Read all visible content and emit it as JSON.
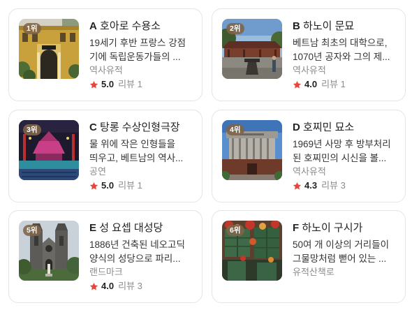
{
  "places": [
    {
      "rank_label": "1위",
      "letter": "A",
      "name": "호아로 수용소",
      "description_lines": [
        "19세기 후반 프랑스 강점",
        "기에 독립운동가들의 ..."
      ],
      "category": "역사유적",
      "rating": "5.0",
      "reviews": "리뷰 1"
    },
    {
      "rank_label": "2위",
      "letter": "B",
      "name": "하노이 문묘",
      "description_lines": [
        "베트남 최초의 대학으로,",
        "1070년 공자와 그의 제..."
      ],
      "category": "역사유적",
      "rating": "4.0",
      "reviews": "리뷰 1"
    },
    {
      "rank_label": "3위",
      "letter": "C",
      "name": "탕롱 수상인형극장",
      "description_lines": [
        "물 위에 작은 인형들을",
        "띄우고, 베트남의 역사..."
      ],
      "category": "공연",
      "rating": "5.0",
      "reviews": "리뷰 1"
    },
    {
      "rank_label": "4위",
      "letter": "D",
      "name": "호찌민 묘소",
      "description_lines": [
        "1969년 사망 후 방부처리",
        "된 호찌민의 시신을 볼..."
      ],
      "category": "역사유적",
      "rating": "4.3",
      "reviews": "리뷰 3"
    },
    {
      "rank_label": "5위",
      "letter": "E",
      "name": "성 요셉 대성당",
      "description_lines": [
        "1886년 건축된 네오고딕",
        "양식의 성당으로 파리..."
      ],
      "category": "랜드마크",
      "rating": "4.0",
      "reviews": "리뷰 3"
    },
    {
      "rank_label": "6위",
      "letter": "F",
      "name": "하노이 구시가",
      "description_lines": [
        "50여 개 이상의 거리들이",
        "그물망처럼 뻗어 있는 ..."
      ],
      "category": "유적산책로"
    }
  ],
  "icons": {
    "rating": "star-icon"
  },
  "colors": {
    "star": "#e8453c",
    "badge_background": "#806448",
    "card_border": "#e4e4e4",
    "muted_text": "#8c8c8c",
    "body_text": "#333333"
  }
}
